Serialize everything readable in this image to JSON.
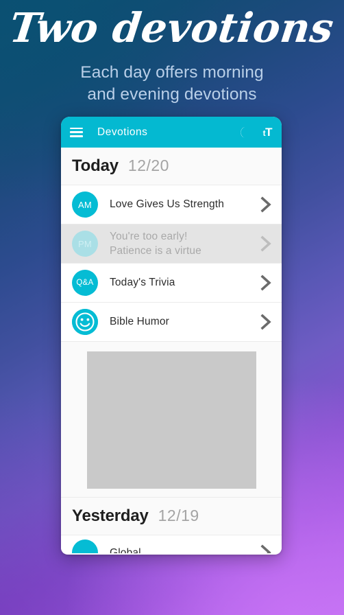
{
  "promo": {
    "headline": "Two devotions",
    "subheadline_line1": "Each day offers morning",
    "subheadline_line2": "and evening devotions"
  },
  "colors": {
    "accent_teal": "#04b9d1",
    "badge_teal": "#05bcd4",
    "badge_disabled": "#aadfe6",
    "gradient_top": "#0d5273",
    "gradient_bottom": "#c274f2",
    "subheadline": "#b9cfe8",
    "chevron_gray": "#6b6b6b",
    "card_bg": "#fafafa",
    "disabled_row_bg": "#e4e4e4",
    "ad_placeholder": "#c9c9c9"
  },
  "appbar": {
    "menu_icon": "hamburger-icon",
    "title": "Devotions",
    "night_mode_icon": "moon-icon",
    "text_size_icon_small": "t",
    "text_size_icon_large": "T"
  },
  "sections": [
    {
      "day_label": "Today",
      "day_date": "12/20",
      "items": [
        {
          "badge": "AM",
          "badge_type": "text",
          "title": "Love Gives Us Strength",
          "subtitle": "",
          "disabled": false
        },
        {
          "badge": "PM",
          "badge_type": "text",
          "title": "You're too early!",
          "subtitle": "Patience is a virtue",
          "disabled": true
        },
        {
          "badge": "Q&A",
          "badge_type": "text",
          "title": "Today's Trivia",
          "subtitle": "",
          "disabled": false
        },
        {
          "badge": "smiley-icon",
          "badge_type": "icon",
          "title": "Bible Humor",
          "subtitle": "",
          "disabled": false
        }
      ]
    },
    {
      "day_label": "Yesterday",
      "day_date": "12/19",
      "items": [
        {
          "badge": "",
          "badge_type": "text",
          "title": "Global",
          "subtitle": "",
          "disabled": false
        }
      ]
    }
  ],
  "ad": {
    "placeholder_label": ""
  }
}
